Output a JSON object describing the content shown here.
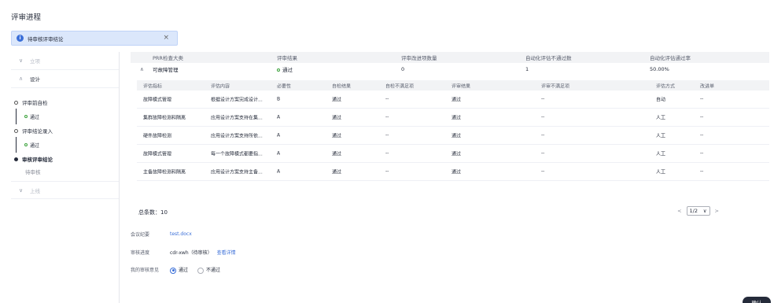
{
  "page": {
    "title": "评审进程"
  },
  "notice": {
    "text": "待审核评审结论",
    "close": "×"
  },
  "stages": [
    {
      "label": "立项",
      "chevron": "∨"
    },
    {
      "label": "设计",
      "chevron": "∧"
    },
    {
      "label": "上线",
      "chevron": "∨"
    }
  ],
  "steps": {
    "s1": {
      "label": "评审前自检",
      "status": "通过"
    },
    "s2": {
      "label": "评审结论录入",
      "status": "通过"
    },
    "s3": {
      "label": "审核评审结论",
      "sub": "待审核"
    }
  },
  "summary": {
    "headers": [
      "PRR检查大类",
      "评审结果",
      "评审改进项数量",
      "自动化评估不通过数",
      "自动化评估通过率"
    ],
    "row": {
      "category": "可故障管理",
      "result": "通过",
      "improve_count": "0",
      "auto_fail": "1",
      "auto_rate": "50.00%"
    },
    "expand_icon": "∧"
  },
  "detail": {
    "headers": [
      "评估指标",
      "评估内容",
      "必要性",
      "自检结果",
      "自检不满足项",
      "评审结果",
      "评审不满足项",
      "评估方式",
      "改进单"
    ],
    "rows": [
      [
        "故障模式管理",
        "根据设计方案完成设计...",
        "B",
        "通过",
        "--",
        "通过",
        "--",
        "自动",
        "--"
      ],
      [
        "集群故障检测和隔离",
        "应用设计方案支持在集...",
        "A",
        "通过",
        "--",
        "通过",
        "--",
        "人工",
        "--"
      ],
      [
        "硬件故障检测",
        "应用设计方案支持所依...",
        "A",
        "通过",
        "--",
        "通过",
        "--",
        "人工",
        "--"
      ],
      [
        "故障模式管理",
        "每一个故障模式都要指...",
        "A",
        "通过",
        "--",
        "通过",
        "--",
        "人工",
        "--"
      ],
      [
        "主备故障检测和隔离",
        "应用设计方案支持主备...",
        "A",
        "通过",
        "--",
        "通过",
        "--",
        "人工",
        "--"
      ]
    ]
  },
  "pagination": {
    "total": "总条数：10",
    "page": "1/2",
    "prev": "<",
    "next": ">",
    "caret": "∨"
  },
  "form": {
    "minutes_label": "会议纪要",
    "minutes_value": "test.docx",
    "progress_label": "审核进度",
    "progress_value": "cdr-xwh（待审核）",
    "progress_link": "查看详情",
    "opinion_label": "我的审核意见",
    "opt_pass": "通过",
    "opt_fail": "不通过"
  },
  "actions": {
    "confirm": "确认"
  }
}
